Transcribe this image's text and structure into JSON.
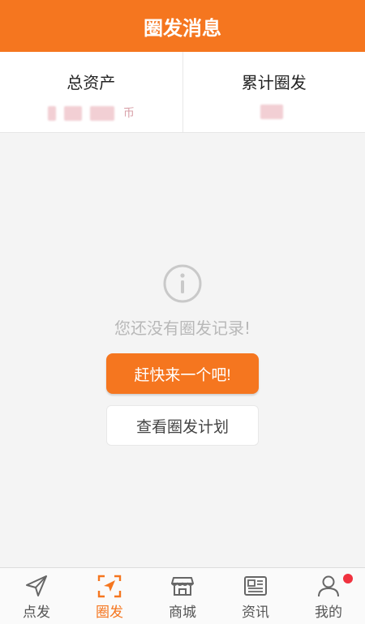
{
  "header": {
    "title": "圈发消息"
  },
  "stats": [
    {
      "label": "总资产",
      "value": "币"
    },
    {
      "label": "累计圈发",
      "value": ""
    }
  ],
  "empty": {
    "message": "您还没有圈发记录!",
    "primary_button": "赶快来一个吧!",
    "secondary_button": "查看圈发计划"
  },
  "nav": {
    "items": [
      {
        "label": "点发",
        "icon": "paper-plane-icon"
      },
      {
        "label": "圈发",
        "icon": "scan-plane-icon",
        "active": true
      },
      {
        "label": "商城",
        "icon": "store-icon"
      },
      {
        "label": "资讯",
        "icon": "news-icon"
      },
      {
        "label": "我的",
        "icon": "user-icon",
        "badge": true
      }
    ]
  },
  "colors": {
    "accent": "#f5761f",
    "badge": "#f0323f"
  }
}
